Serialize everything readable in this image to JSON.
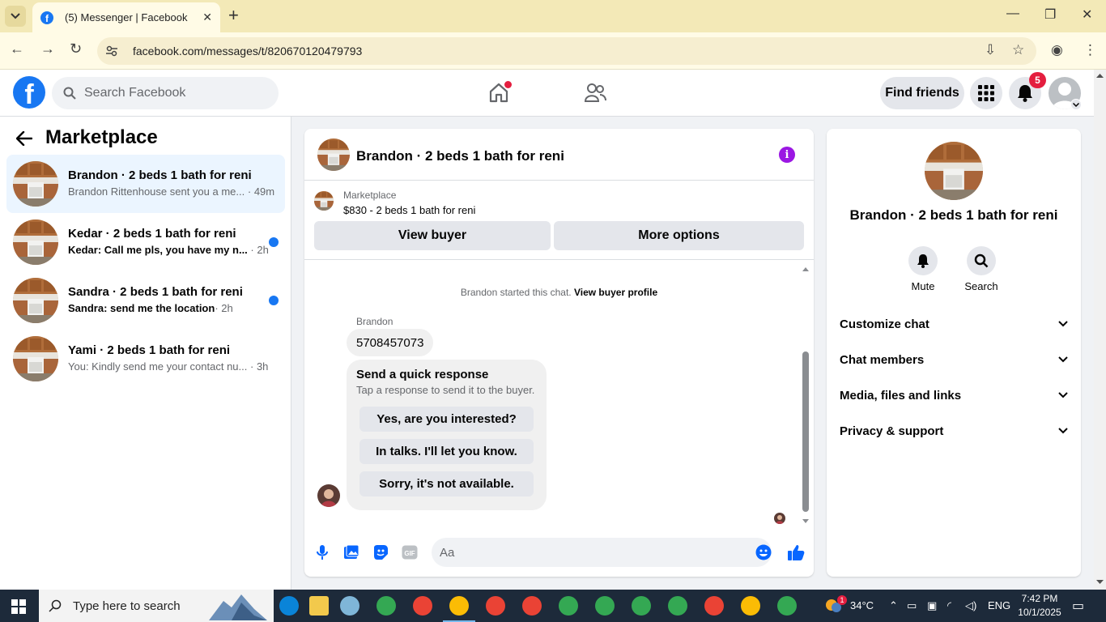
{
  "browser": {
    "tab_title": "(5) Messenger | Facebook",
    "url": "facebook.com/messages/t/820670120479793"
  },
  "header": {
    "search_placeholder": "Search Facebook",
    "find_friends": "Find friends",
    "notification_count": "5"
  },
  "sidebar": {
    "title": "Marketplace",
    "conversations": [
      {
        "title": "Brandon · 2 beds 1 bath for reni",
        "preview": "Brandon Rittenhouse sent you a me...",
        "time": "· 49m",
        "unread": false,
        "active": true
      },
      {
        "title": "Kedar · 2 beds 1 bath for reni",
        "preview": "Kedar: Call me pls, you have my n...",
        "time": "· 2h",
        "unread": true,
        "active": false
      },
      {
        "title": "Sandra · 2 beds 1 bath for reni",
        "preview": "Sandra: send me the location",
        "time": "· 2h",
        "unread": true,
        "active": false
      },
      {
        "title": "Yami · 2 beds 1 bath for reni",
        "preview": "You: Kindly send me your contact nu...",
        "time": "· 3h",
        "unread": false,
        "active": false
      }
    ]
  },
  "chat": {
    "title": "Brandon · 2 beds 1 bath for reni",
    "marketplace_label": "Marketplace",
    "listing": "$830 - 2 beds 1 bath for reni",
    "view_buyer": "View buyer",
    "more_options": "More options",
    "system_text": "Brandon started this chat.",
    "system_link": "View buyer profile",
    "sender_name": "Brandon",
    "message": "5708457073",
    "quick_title": "Send a quick response",
    "quick_sub": "Tap a response to send it to the buyer.",
    "quick_replies": [
      "Yes, are you interested?",
      "In talks. I'll let you know.",
      "Sorry, it's not available."
    ],
    "composer_placeholder": "Aa"
  },
  "details": {
    "name": "Brandon · 2 beds 1 bath for reni",
    "mute": "Mute",
    "search": "Search",
    "sections": [
      "Customize chat",
      "Chat members",
      "Media, files and links",
      "Privacy & support"
    ]
  },
  "taskbar": {
    "search_placeholder": "Type here to search",
    "temperature": "34°C",
    "language": "ENG",
    "time": "7:42 PM",
    "date": "10/1/2025",
    "weather_badge": "1"
  },
  "colors": {
    "brand": "#1877f2",
    "info": "#9b17e3",
    "badge": "#e41e3f"
  }
}
